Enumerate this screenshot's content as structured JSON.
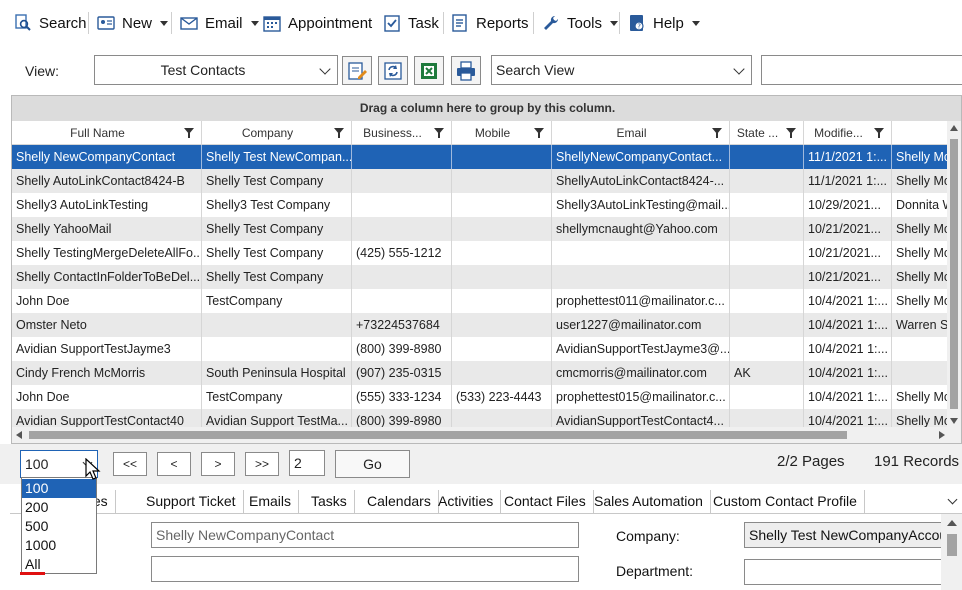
{
  "toolbar": {
    "search": "Search",
    "new": "New",
    "email": "Email",
    "appointment": "Appointment",
    "task": "Task",
    "reports": "Reports",
    "tools": "Tools",
    "help": "Help"
  },
  "viewbar": {
    "label": "View:",
    "view_value": "Test Contacts",
    "search_view": "Search View",
    "search_text": ""
  },
  "grid": {
    "group_hint": "Drag a column here to group by this column.",
    "columns": [
      "Full Name",
      "Company",
      "Business...",
      "Mobile",
      "Email",
      "State ...",
      "Modifie..."
    ],
    "rows": [
      [
        "Shelly NewCompanyContact",
        "Shelly  Test  NewCompan...",
        "",
        "",
        "ShellyNewCompanyContact...",
        "",
        "11/1/2021 1:...",
        "Shelly McN"
      ],
      [
        "Shelly AutoLinkContact8424-B",
        "Shelly Test Company",
        "",
        "",
        "ShellyAutoLinkContact8424-...",
        "",
        "11/1/2021 1:...",
        "Shelly McN"
      ],
      [
        "Shelly3 AutoLinkTesting",
        "Shelly3 Test Company",
        "",
        "",
        "Shelly3AutoLinkTesting@mail...",
        "",
        "10/29/2021...",
        "Donnita W"
      ],
      [
        "Shelly YahooMail",
        "Shelly Test Company",
        "",
        "",
        "shellymcnaught@Yahoo.com",
        "",
        "10/21/2021...",
        "Shelly McN"
      ],
      [
        "Shelly  TestingMergeDeleteAllFo...",
        "Shelly Test Company",
        "(425) 555-1212",
        "",
        "",
        "",
        "10/21/2021...",
        "Shelly McN"
      ],
      [
        "Shelly  ContactInFolderToBeDel...",
        "Shelly Test Company",
        "",
        "",
        "",
        "",
        "10/21/2021...",
        "Shelly McN"
      ],
      [
        "John Doe",
        "TestCompany",
        "",
        "",
        "prophettest011@mailinator.c...",
        "",
        "10/4/2021 1:...",
        "Shelly Mc"
      ],
      [
        "Omster Neto",
        "",
        "+73224537684",
        "",
        "user1227@mailinator.com",
        "",
        "10/4/2021 1:...",
        "Warren Sto"
      ],
      [
        "Avidian SupportTestJayme3",
        "",
        "(800) 399-8980",
        "",
        "AvidianSupportTestJayme3@...",
        "",
        "10/4/2021 1:...",
        ""
      ],
      [
        "Cindy French McMorris",
        "South Peninsula Hospital",
        "(907) 235-0315",
        "",
        "cmcmorris@mailinator.com",
        "AK",
        "10/4/2021 1:...",
        ""
      ],
      [
        "John Doe",
        "TestCompany",
        "(555) 333-1234",
        "(533) 223-4443",
        "prophettest015@mailinator.c...",
        "",
        "10/4/2021 1:...",
        "Shelly McN"
      ],
      [
        "Avidian SupportTestContact40",
        "Avidian  Support  TestMa...",
        "(800) 399-8980",
        "",
        "AvidianSupportTestContact4...",
        "",
        "10/4/2021 1:...",
        "Shelly McN"
      ]
    ]
  },
  "pager": {
    "page_size": "100",
    "first": "<<",
    "prev": "<",
    "next": ">",
    "last": ">>",
    "page_number": "2",
    "go": "Go",
    "pages_info": "2/2 Pages",
    "records_info": "191 Records"
  },
  "page_size_options": [
    "100",
    "200",
    "500",
    "1000",
    "All"
  ],
  "tabs": [
    "tes",
    "Support Ticket",
    "Emails",
    "Tasks",
    "Calendars",
    "Activities",
    "Contact Files",
    "Sales Automation",
    "Custom Contact Profile"
  ],
  "detail": {
    "name_value": "Shelly NewCompanyContact",
    "second_value": "",
    "company_label": "Company:",
    "company_value": "Shelly Test NewCompanyAccount",
    "department_label": "Department:",
    "department_value": ""
  },
  "colors": {
    "selection": "#1f63b5",
    "alt_row": "#e9e9e9",
    "annotation": "#e01010"
  }
}
